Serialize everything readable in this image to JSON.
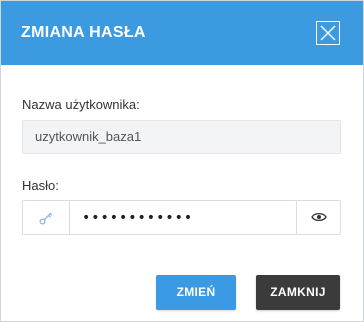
{
  "dialog": {
    "title": "ZMIANA HASŁA",
    "close_icon": "close-icon",
    "header_color": "#3c9be0"
  },
  "form": {
    "username": {
      "label": "Nazwa użytkownika:",
      "value": "uzytkownik_baza1"
    },
    "password": {
      "label": "Hasło:",
      "value": "••••••••••••",
      "prefix_icon": "generate-key-icon",
      "toggle_icon": "eye-icon"
    }
  },
  "buttons": {
    "change_label": "ZMIEŃ",
    "change_color": "#3a9ae3",
    "close_label": "ZAMKNIJ",
    "close_color": "#3b3b3b"
  }
}
